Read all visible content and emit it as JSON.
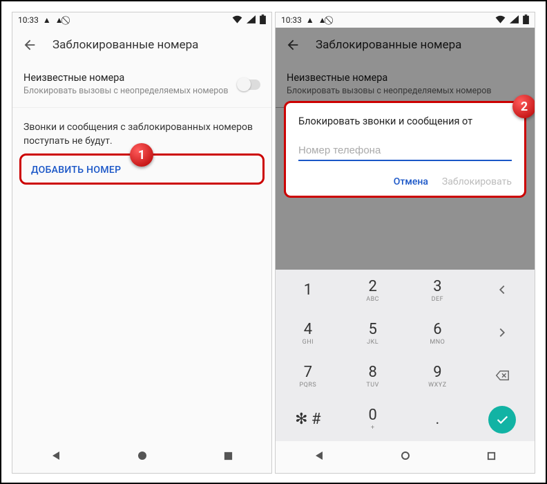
{
  "status": {
    "time": "10:33",
    "icons": [
      "warning-icon",
      "warning-icon",
      "no-sign-icon"
    ],
    "right": [
      "wifi-icon",
      "signal-icon",
      "battery-icon"
    ]
  },
  "colors": {
    "accent": "#1a56c7",
    "highlight": "#cc0000",
    "done": "#12b3a4"
  },
  "header": {
    "title": "Заблокированные номера"
  },
  "setting": {
    "title": "Неизвестные номера",
    "subtitle": "Блокировать вызовы с неопределяемых номеров",
    "enabled": false
  },
  "info_text": "Звонки и сообщения с заблокированных номеров поступать не будут.",
  "add_number_label": "ДОБАВИТЬ НОМЕР",
  "markers": {
    "m1": "1",
    "m2": "2"
  },
  "dialog": {
    "title": "Блокировать звонки и сообщения от",
    "placeholder": "Номер телефона",
    "value": "",
    "cancel": "Отмена",
    "confirm": "Заблокировать"
  },
  "keypad": {
    "rows": [
      [
        {
          "n": "1",
          "l": ""
        },
        {
          "n": "2",
          "l": "ABC"
        },
        {
          "n": "3",
          "l": "DEF"
        },
        {
          "icon": "chevron-left-icon"
        }
      ],
      [
        {
          "n": "4",
          "l": "GHI"
        },
        {
          "n": "5",
          "l": "JKL"
        },
        {
          "n": "6",
          "l": "MNO"
        },
        {
          "icon": "chevron-right-icon"
        }
      ],
      [
        {
          "n": "7",
          "l": "PQRS"
        },
        {
          "n": "8",
          "l": "TUV"
        },
        {
          "n": "9",
          "l": "WXYZ"
        },
        {
          "icon": "backspace-icon"
        }
      ],
      [
        {
          "n": "✻ #",
          "l": ""
        },
        {
          "n": "0",
          "l": "+"
        },
        {
          "n": ".",
          "l": ""
        },
        {
          "icon": "done-icon"
        }
      ]
    ]
  },
  "nav": [
    "back-triangle",
    "home-circle",
    "recent-square"
  ]
}
